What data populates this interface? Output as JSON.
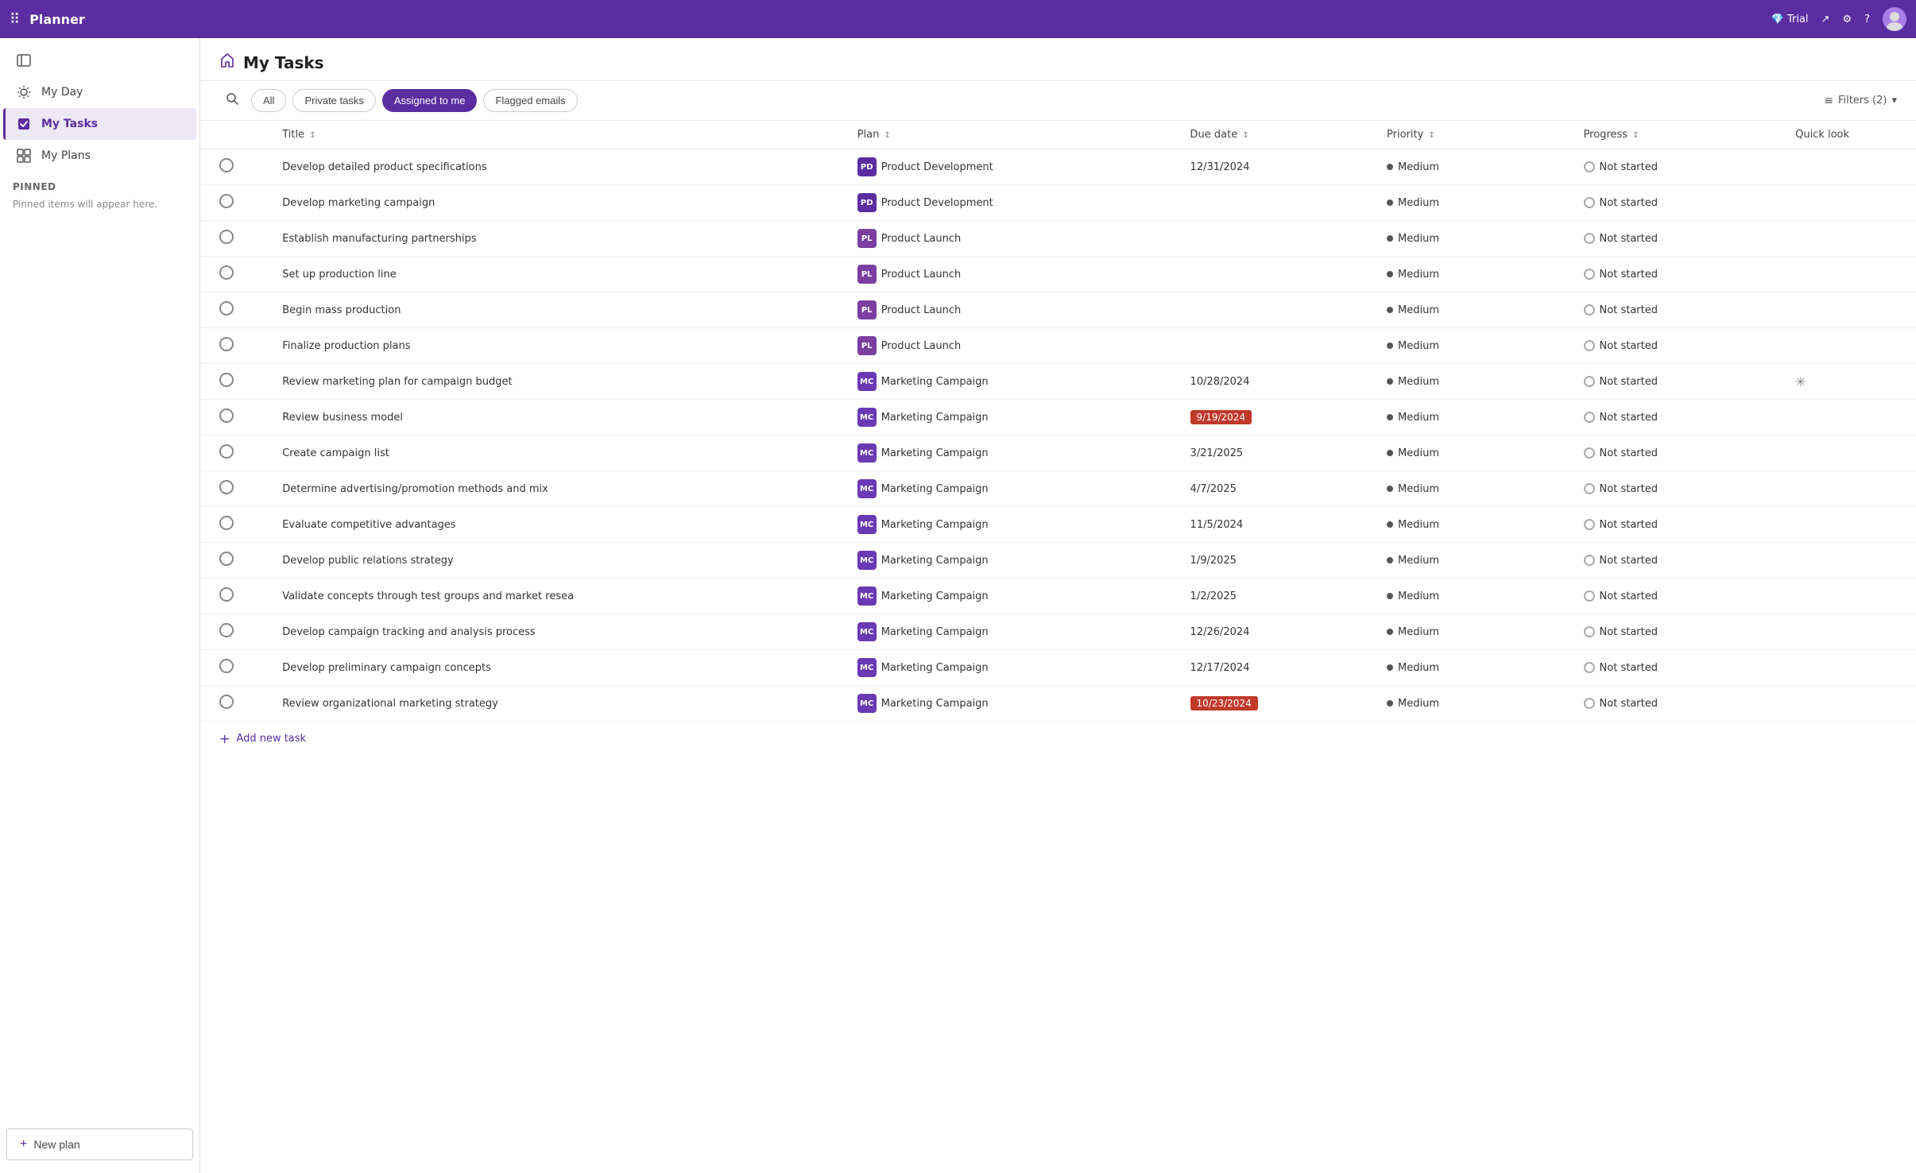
{
  "topbar": {
    "app_name": "Planner",
    "trial_label": "Trial",
    "icons": {
      "grid_dots": "⠿",
      "share": "↗",
      "settings": "⚙",
      "help": "?"
    }
  },
  "sidebar": {
    "toggle_icon": "☰",
    "items": [
      {
        "id": "my-day",
        "label": "My Day",
        "icon": "☀"
      },
      {
        "id": "my-tasks",
        "label": "My Tasks",
        "icon": "✓",
        "active": true
      },
      {
        "id": "my-plans",
        "label": "My Plans",
        "icon": "⊞"
      }
    ],
    "pinned_section": "Pinned",
    "pinned_note": "Pinned items will appear here.",
    "new_plan_label": "New plan",
    "new_plan_icon": "+"
  },
  "page": {
    "title": "My Tasks",
    "icon": "⌂"
  },
  "tabs": {
    "items": [
      {
        "id": "all",
        "label": "All",
        "active": false
      },
      {
        "id": "private-tasks",
        "label": "Private tasks",
        "active": false
      },
      {
        "id": "assigned-to-me",
        "label": "Assigned to me",
        "active": true
      },
      {
        "id": "flagged-emails",
        "label": "Flagged emails",
        "active": false
      }
    ],
    "filter_label": "Filters (2)",
    "filter_icon": "≡"
  },
  "table": {
    "columns": [
      {
        "id": "checkbox",
        "label": ""
      },
      {
        "id": "title",
        "label": "Title",
        "sort": true
      },
      {
        "id": "plan",
        "label": "Plan",
        "sort": true
      },
      {
        "id": "due-date",
        "label": "Due date",
        "sort": true
      },
      {
        "id": "priority",
        "label": "Priority",
        "sort": true
      },
      {
        "id": "progress",
        "label": "Progress",
        "sort": true
      },
      {
        "id": "quicklook",
        "label": "Quick look",
        "sort": false
      }
    ],
    "rows": [
      {
        "id": 1,
        "title": "Develop detailed product specifications",
        "plan": "Product Development",
        "plan_code": "PD",
        "plan_type": "pd",
        "due_date": "12/31/2024",
        "due_overdue": false,
        "priority": "Medium",
        "progress": "Not started",
        "quicklook": false
      },
      {
        "id": 2,
        "title": "Develop marketing campaign",
        "plan": "Product Development",
        "plan_code": "PD",
        "plan_type": "pd",
        "due_date": "",
        "due_overdue": false,
        "priority": "Medium",
        "progress": "Not started",
        "quicklook": false
      },
      {
        "id": 3,
        "title": "Establish manufacturing partnerships",
        "plan": "Product Launch",
        "plan_code": "PL",
        "plan_type": "pl",
        "due_date": "",
        "due_overdue": false,
        "priority": "Medium",
        "progress": "Not started",
        "quicklook": false
      },
      {
        "id": 4,
        "title": "Set up production line",
        "plan": "Product Launch",
        "plan_code": "PL",
        "plan_type": "pl",
        "due_date": "",
        "due_overdue": false,
        "priority": "Medium",
        "progress": "Not started",
        "quicklook": false
      },
      {
        "id": 5,
        "title": "Begin mass production",
        "plan": "Product Launch",
        "plan_code": "PL",
        "plan_type": "pl",
        "due_date": "",
        "due_overdue": false,
        "priority": "Medium",
        "progress": "Not started",
        "quicklook": false
      },
      {
        "id": 6,
        "title": "Finalize production plans",
        "plan": "Product Launch",
        "plan_code": "PL",
        "plan_type": "pl",
        "due_date": "",
        "due_overdue": false,
        "priority": "Medium",
        "progress": "Not started",
        "quicklook": false
      },
      {
        "id": 7,
        "title": "Review marketing plan for campaign budget",
        "plan": "Marketing Campaign",
        "plan_code": "MC",
        "plan_type": "mc",
        "due_date": "10/28/2024",
        "due_overdue": false,
        "priority": "Medium",
        "progress": "Not started",
        "quicklook": true
      },
      {
        "id": 8,
        "title": "Review business model",
        "plan": "Marketing Campaign",
        "plan_code": "MC",
        "plan_type": "mc",
        "due_date": "9/19/2024",
        "due_overdue": true,
        "priority": "Medium",
        "progress": "Not started",
        "quicklook": false
      },
      {
        "id": 9,
        "title": "Create campaign list",
        "plan": "Marketing Campaign",
        "plan_code": "MC",
        "plan_type": "mc",
        "due_date": "3/21/2025",
        "due_overdue": false,
        "priority": "Medium",
        "progress": "Not started",
        "quicklook": false
      },
      {
        "id": 10,
        "title": "Determine advertising/promotion methods and mix",
        "plan": "Marketing Campaign",
        "plan_code": "MC",
        "plan_type": "mc",
        "due_date": "4/7/2025",
        "due_overdue": false,
        "priority": "Medium",
        "progress": "Not started",
        "quicklook": false
      },
      {
        "id": 11,
        "title": "Evaluate competitive advantages",
        "plan": "Marketing Campaign",
        "plan_code": "MC",
        "plan_type": "mc",
        "due_date": "11/5/2024",
        "due_overdue": false,
        "priority": "Medium",
        "progress": "Not started",
        "quicklook": false
      },
      {
        "id": 12,
        "title": "Develop public relations strategy",
        "plan": "Marketing Campaign",
        "plan_code": "MC",
        "plan_type": "mc",
        "due_date": "1/9/2025",
        "due_overdue": false,
        "priority": "Medium",
        "progress": "Not started",
        "quicklook": false
      },
      {
        "id": 13,
        "title": "Validate concepts through test groups and market resea",
        "plan": "Marketing Campaign",
        "plan_code": "MC",
        "plan_type": "mc",
        "due_date": "1/2/2025",
        "due_overdue": false,
        "priority": "Medium",
        "progress": "Not started",
        "quicklook": false
      },
      {
        "id": 14,
        "title": "Develop campaign tracking and analysis process",
        "plan": "Marketing Campaign",
        "plan_code": "MC",
        "plan_type": "mc",
        "due_date": "12/26/2024",
        "due_overdue": false,
        "priority": "Medium",
        "progress": "Not started",
        "quicklook": false
      },
      {
        "id": 15,
        "title": "Develop preliminary campaign concepts",
        "plan": "Marketing Campaign",
        "plan_code": "MC",
        "plan_type": "mc",
        "due_date": "12/17/2024",
        "due_overdue": false,
        "priority": "Medium",
        "progress": "Not started",
        "quicklook": false
      },
      {
        "id": 16,
        "title": "Review organizational marketing strategy",
        "plan": "Marketing Campaign",
        "plan_code": "MC",
        "plan_type": "mc",
        "due_date": "10/23/2024",
        "due_overdue": true,
        "priority": "Medium",
        "progress": "Not started",
        "quicklook": false
      }
    ],
    "add_task_label": "Add new task",
    "add_task_icon": "+"
  },
  "colors": {
    "brand_purple": "#5b2da0",
    "overdue_red": "#c0392b",
    "medium_dot": "#555555"
  }
}
